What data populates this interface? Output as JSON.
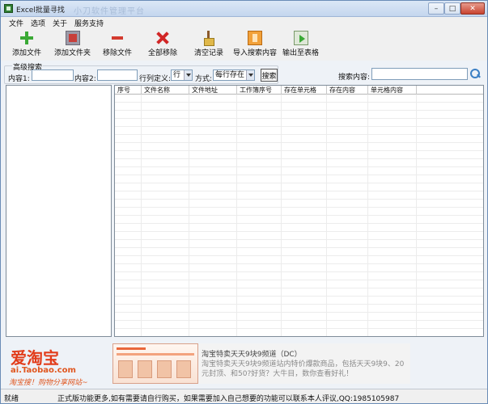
{
  "window": {
    "title": "Excel批量寻找",
    "title_watermark": "小刀软件管理平台",
    "buttons": {
      "minimize": "–",
      "maximize": "□",
      "close": "✕"
    }
  },
  "menu": [
    "文件",
    "选项",
    "关于",
    "服务支持"
  ],
  "toolbar": [
    {
      "label": "添加文件",
      "icon": "add-file-icon"
    },
    {
      "label": "添加文件夹",
      "icon": "add-folder-icon"
    },
    {
      "label": "移除文件",
      "icon": "remove-file-icon"
    },
    {
      "label": "全部移除",
      "icon": "remove-all-icon"
    },
    {
      "label": "清空记录",
      "icon": "clear-records-icon"
    },
    {
      "label": "导入搜索内容",
      "icon": "import-search-icon"
    },
    {
      "label": "输出至表格",
      "icon": "export-table-icon"
    }
  ],
  "advanced_search": {
    "legend": "高级搜索",
    "content1_label": "内容1:",
    "content1_value": "",
    "content2_label": "内容2:",
    "content2_value": "",
    "rowcol_label": "行列定义:",
    "rowcol_value": "行",
    "mode_label": "方式:",
    "mode_value": "每行存在",
    "search_button": "搜索"
  },
  "search_content": {
    "label": "搜索内容:",
    "value": ""
  },
  "grid": {
    "columns": [
      "序号",
      "文件名称",
      "文件地址",
      "工作簿序号",
      "存在单元格",
      "存在内容",
      "单元格内容"
    ]
  },
  "ad": {
    "brand": "爱淘宝",
    "site": "ai.Taobao.com",
    "slogan": "淘宝搜！购物分享网站~",
    "headline": "淘宝特卖天天9块9频道（DC）",
    "description": "淘宝特卖天天9块9频道站内特价爆款商品，包括天天9块9、20元封顶、和50?好货？大牛目，数你查看好礼！"
  },
  "status": {
    "left": "就绪",
    "message": "正式版功能更多,如有需要请自行购买，如果需要加入自己想要的功能可以联系本人评议,QQ:1985105987"
  }
}
